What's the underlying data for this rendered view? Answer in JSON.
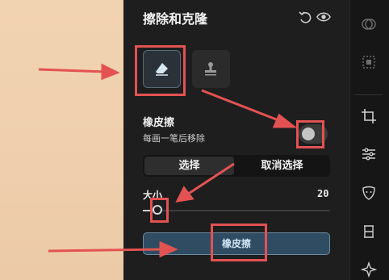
{
  "panel": {
    "title": "擦除和克隆",
    "header_icons": [
      "undo-icon",
      "eye-icon"
    ]
  },
  "tools": [
    {
      "name": "eraser-tool",
      "icon": "eraser-icon",
      "selected": true
    },
    {
      "name": "clone-stamp-tool",
      "icon": "stamp-icon",
      "selected": false
    }
  ],
  "eraser": {
    "title": "橡皮擦",
    "description": "每画一笔后移除",
    "toggle_on": false
  },
  "selection": {
    "select_label": "选择",
    "deselect_label": "取消选择",
    "active": "select"
  },
  "size": {
    "label": "大小",
    "value": "20",
    "fraction": 0.1
  },
  "apply_button": {
    "label": "橡皮擦"
  },
  "right_toolbar": [
    "healing-icon",
    "selection-icon",
    "crop-icon",
    "adjust-sliders-icon",
    "face-retouch-icon",
    "frame-icon",
    "sparkle-icon"
  ],
  "colors": {
    "annotation": "#e35252",
    "accent": "#2f4c63",
    "canvas": "#f0d0ae"
  }
}
